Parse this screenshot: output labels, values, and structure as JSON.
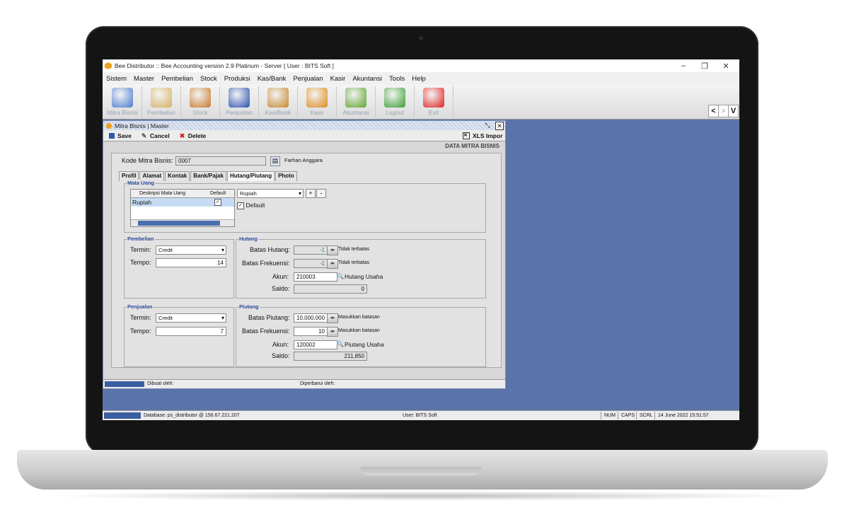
{
  "app": {
    "title": "Bee Distributor :: Bee Accounting version 2.9 Platinum - Server  [ User : BITS Soft ]"
  },
  "window_controls": {
    "minimize": "–",
    "restore": "❐",
    "close": "✕"
  },
  "menu": [
    "Sistem",
    "Master",
    "Pembelian",
    "Stock",
    "Produksi",
    "Kas/Bank",
    "Penjualan",
    "Kasir",
    "Akuntansi",
    "Tools",
    "Help"
  ],
  "toolbar": [
    {
      "label": "Mitra Bisnis",
      "icon": "users-icon",
      "color": "#4a7bd0"
    },
    {
      "label": "Pembelian",
      "icon": "purchase-icon",
      "color": "#d8b060"
    },
    {
      "label": "Stock",
      "icon": "box-icon",
      "color": "#c87a2a"
    },
    {
      "label": "Penjualan",
      "icon": "shopping-bag-icon",
      "color": "#2a4fb0"
    },
    {
      "label": "Kas/Bank",
      "icon": "money-bag-icon",
      "color": "#c8862a"
    },
    {
      "label": "Kasir",
      "icon": "cart-icon",
      "color": "#e08a1a"
    },
    {
      "label": "Akuntansi",
      "icon": "chart-up-icon",
      "color": "#5aa52a"
    },
    {
      "label": "Logout",
      "icon": "logout-icon",
      "color": "#3aa030"
    },
    {
      "label": "Exit",
      "icon": "power-icon",
      "color": "#e02020"
    }
  ],
  "nav": {
    "prev": "<",
    "next": ">",
    "down": "V"
  },
  "child": {
    "title": "Mitra Bisnis | Master",
    "actions": {
      "save": "Save",
      "cancel": "Cancel",
      "delete": "Delete",
      "import": "XLS Impor"
    },
    "section": "DATA MITRA BISNIS",
    "kode_label": "Kode Mitra Bisnis:",
    "kode_value": "0007",
    "name_value": "Farhan Anggara",
    "tabs": [
      "Profil",
      "Alamat",
      "Kontak",
      "Bank/Pajak",
      "Hutang/Piutang",
      "Photo"
    ],
    "mata_uang": {
      "title": "Mata Uang",
      "col_desc": "Deskripsi Mata Uang",
      "col_default": "Default",
      "row_desc": "Rupiah",
      "row_default": "✓",
      "select": "Rupiah",
      "default_label": "Default",
      "add": "+",
      "remove": "-"
    },
    "pembelian": {
      "title": "Pembelian",
      "termin_label": "Termin:",
      "termin_value": "Credit",
      "tempo_label": "Tempo:",
      "tempo_value": "14"
    },
    "hutang": {
      "title": "Hutang",
      "batas_label": "Batas Hutang:",
      "batas_value": "-1",
      "batas_note": "Tidak terbatas",
      "frek_label": "Batas Frekuensi:",
      "frek_value": "-1",
      "frek_note": "Tidak terbatas",
      "akun_label": "Akun:",
      "akun_value": "210003",
      "akun_name": "Hutang Usaha",
      "saldo_label": "Saldo:",
      "saldo_value": "0"
    },
    "penjualan": {
      "title": "Penjualan",
      "termin_label": "Termin:",
      "termin_value": "Credit",
      "tempo_label": "Tempo:",
      "tempo_value": "7"
    },
    "piutang": {
      "title": "Piutang",
      "batas_label": "Batas Piutang:",
      "batas_value": "10,000,000",
      "batas_note": "Masukkan batasan",
      "frek_label": "Batas Frekuensi:",
      "frek_value": "10",
      "frek_note": "Masukkan batasan",
      "akun_label": "Akun:",
      "akun_value": "120002",
      "akun_name": "Piutang Usaha",
      "saldo_label": "Saldo:",
      "saldo_value": "211,850"
    },
    "status": {
      "dibuat": "Dibuat oleh:",
      "diperbarui": "Diperbarui oleh:"
    }
  },
  "statusbar": {
    "database": "Database: ps_distributor @ 156.67.221.207",
    "user": "User: BITS Soft",
    "num": "NUM",
    "caps": "CAPS",
    "scrl": "SCRL",
    "datetime": "14 June 2022   15:51:57"
  }
}
